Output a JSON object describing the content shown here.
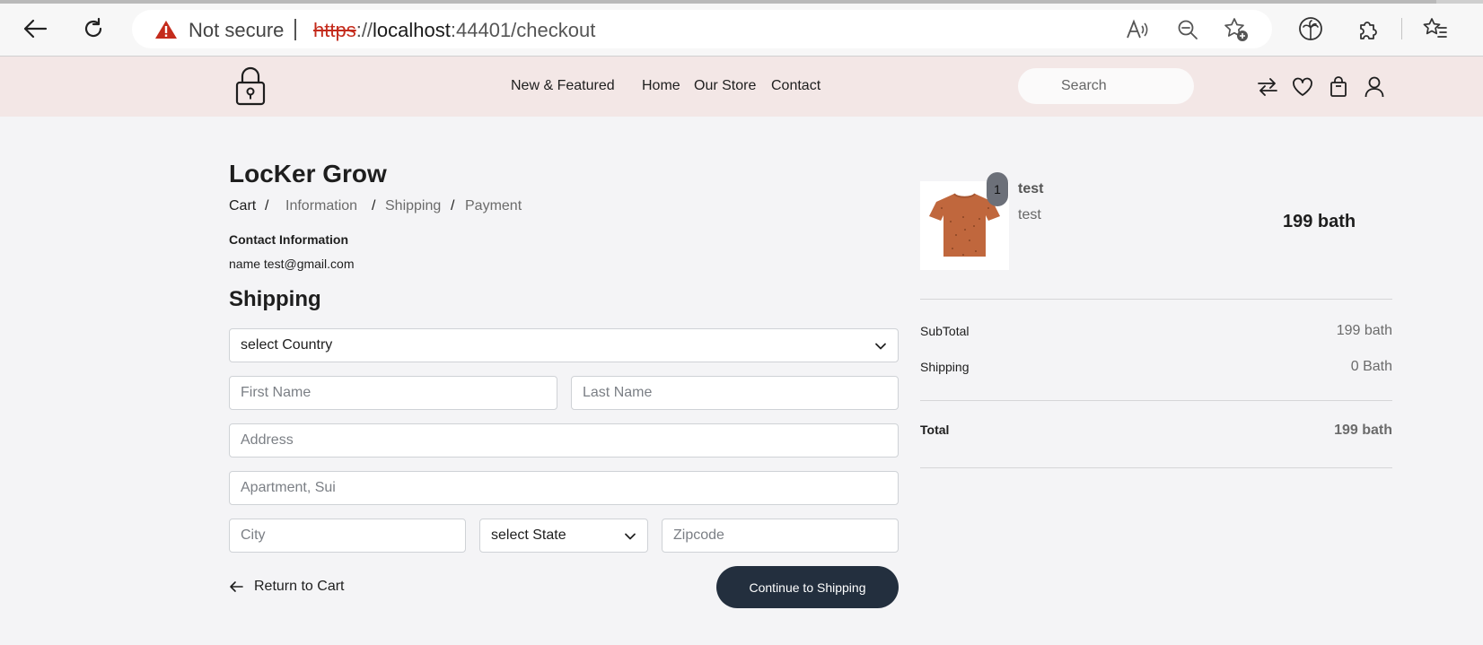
{
  "browser": {
    "security_label": "Not secure",
    "url_protocol": "https",
    "url_separator": "://",
    "url_host": "localhost",
    "url_rest": ":44401/checkout",
    "icons": [
      "back-icon",
      "refresh-icon",
      "warning-icon",
      "read-aloud-icon",
      "zoom-out-icon",
      "add-favorite-icon",
      "extension-palm-icon",
      "extensions-icon",
      "favorites-icon"
    ]
  },
  "header": {
    "nav": {
      "new_featured": "New & Featured",
      "home": "Home",
      "our_store": "Our Store",
      "contact": "Contact"
    },
    "search_placeholder": "Search",
    "icons": [
      "lock-logo-icon",
      "compare-icon",
      "heart-icon",
      "bag-icon",
      "user-icon"
    ]
  },
  "checkout": {
    "store_title": "LocKer Grow",
    "breadcrumb": {
      "cart": "Cart",
      "information": "Information",
      "shipping": "Shipping",
      "payment": "Payment",
      "separator": "/"
    },
    "contact_heading": "Contact Information",
    "contact_value": "name test@gmail.com",
    "shipping_heading": "Shipping",
    "form": {
      "country_selected": "select Country",
      "first_name_placeholder": "First Name",
      "last_name_placeholder": "Last Name",
      "address_placeholder": "Address",
      "apartment_placeholder": "Apartment, Sui",
      "city_placeholder": "City",
      "state_selected": "select State",
      "zipcode_placeholder": "Zipcode"
    },
    "return_label": "Return to Cart",
    "continue_label": "Continue to Shipping"
  },
  "summary": {
    "item": {
      "quantity": "1",
      "name": "test",
      "variant": "test",
      "price": "199 bath"
    },
    "subtotal_label": "SubTotal",
    "subtotal_value": "199 bath",
    "shipping_label": "Shipping",
    "shipping_value": "0 Bath",
    "total_label": "Total",
    "total_value": "199 bath"
  },
  "colors": {
    "header_bg": "#f3e7e6",
    "page_bg": "#f4f4f6",
    "button_bg": "#232f3e",
    "warning_red": "#c42b1c",
    "product_orange": "#c0673d"
  }
}
